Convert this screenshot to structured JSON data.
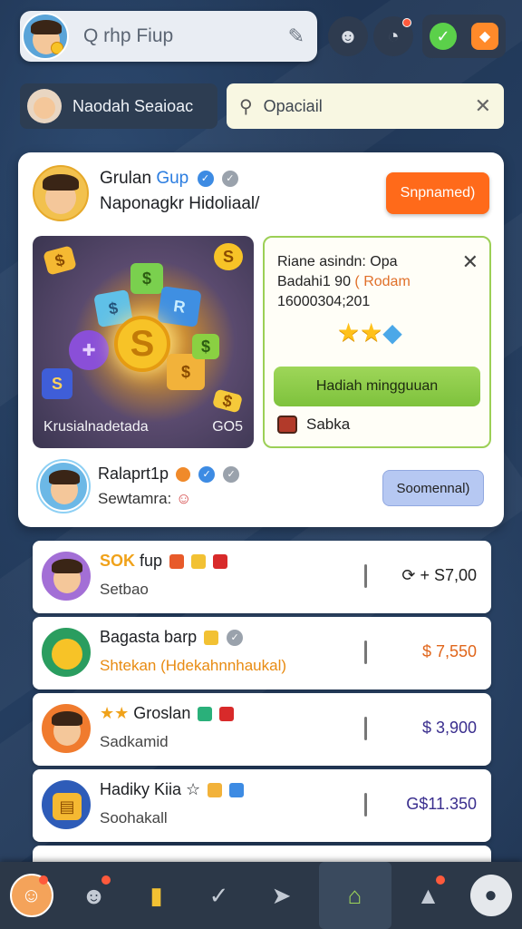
{
  "topbar": {
    "search_text": "Q rhp Fiup",
    "tool_icon": "wrench-icon"
  },
  "profile_chip": {
    "label": "Naodah Seaioac"
  },
  "search": {
    "placeholder": "Opaciail"
  },
  "main_card": {
    "title": "Grulan",
    "title_accent": "Gup",
    "subtitle": "Naponagkr Hidoliaal/",
    "action_label": "Snpnamed)",
    "image_caption": "Krusialnadetada",
    "image_count": "GO5",
    "info": {
      "line1": "Riane asindn: Opa",
      "line2_a": "Badahi1 90",
      "line2_b": "( Rodam",
      "line3": "16000304;201",
      "button_label": "Hadiah mingguuan",
      "chest_label": "Sabka"
    },
    "footer": {
      "name": "Ralaprt1p",
      "sub": "Sewtamra:",
      "button_label": "Soomennal)"
    }
  },
  "list": [
    {
      "name_gold": "SOK",
      "name": "fup",
      "sub": "Setbao",
      "price": "⟳ + S7,00",
      "price_style": "plain",
      "avatar_color": "#a36fd6"
    },
    {
      "name_gold": "",
      "name": "Bagasta barp",
      "sub": "Shtekan (Hdekahnnhaukal)",
      "price": "$ 7,550",
      "price_style": "gold",
      "avatar_color": "#2a9d5f"
    },
    {
      "name_gold": "★★",
      "name": "Groslan",
      "sub": "Sadkamid",
      "price": "$ 3,900",
      "price_style": "indigo",
      "avatar_color": "#f07b2e"
    },
    {
      "name_gold": "",
      "name": "Hadiky Kiia ☆",
      "sub": "Soohakall",
      "price": "G$11.350",
      "price_style": "indigo",
      "avatar_color": "#2e5cb8"
    }
  ],
  "colors": {
    "accent_orange": "#ff6a1a",
    "accent_green": "#9ed659",
    "accent_blue": "#b6c8f2"
  }
}
